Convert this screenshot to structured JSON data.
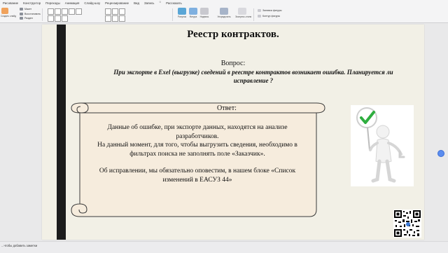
{
  "ribbon": {
    "tabs": [
      {
        "label": "Рисование",
        "active": false
      },
      {
        "label": "Конструктор",
        "active": false
      },
      {
        "label": "Переходы",
        "active": false
      },
      {
        "label": "Анимация",
        "active": false
      },
      {
        "label": "Слайд-шоу",
        "active": false
      },
      {
        "label": "Рецензирование",
        "active": false
      },
      {
        "label": "Вид",
        "active": false
      },
      {
        "label": "Запись",
        "active": false
      },
      {
        "label": "Рассказать",
        "active": false
      }
    ],
    "slide_group": {
      "create_slide": "Создать слайд",
      "layout": "Макет",
      "reset": "Восстановить",
      "section": "Раздел"
    },
    "insert_group": {
      "picture": "Рисунок",
      "shape": "Фигура",
      "text": "Надпись",
      "arrange": "Упорядочить",
      "styles": "Экспресс-стили"
    },
    "right_group": {
      "item1": "Заливка фигуры",
      "item2": "Контур фигуры"
    },
    "share_label": "Рассказать"
  },
  "slide": {
    "title": "Реестр контрактов.",
    "question_label": "Вопрос:",
    "question_text": "При экспорте в Exel (выгрузке) сведений в реестре контрактов возникает ошибка. Планируется ли исправление ?",
    "answer_label": "Ответ:",
    "answer_p1": "Данные об ошибке, при экспорте данных, находятся на анализе разработчиков.",
    "answer_p2": "На данный момент, для того, чтобы выгрузить сведения, необходимо в фильтрах поиска не заполнять поле «Заказчик».",
    "answer_p3": "Об исправлении, мы обязательно оповестим, в нашем блоке «Список изменений в ЕАСУЗ 44»",
    "figure_icon": "checkmark-sign-figure",
    "qr_icon": "qr-code"
  },
  "status": {
    "notes_hint": "...чтобы добавить заметки"
  },
  "colors": {
    "slide_bg": "#f2f0e6",
    "bar": "#1c1c1c",
    "scroll_fill": "#f6ecdd",
    "check_green": "#2fae3f"
  }
}
